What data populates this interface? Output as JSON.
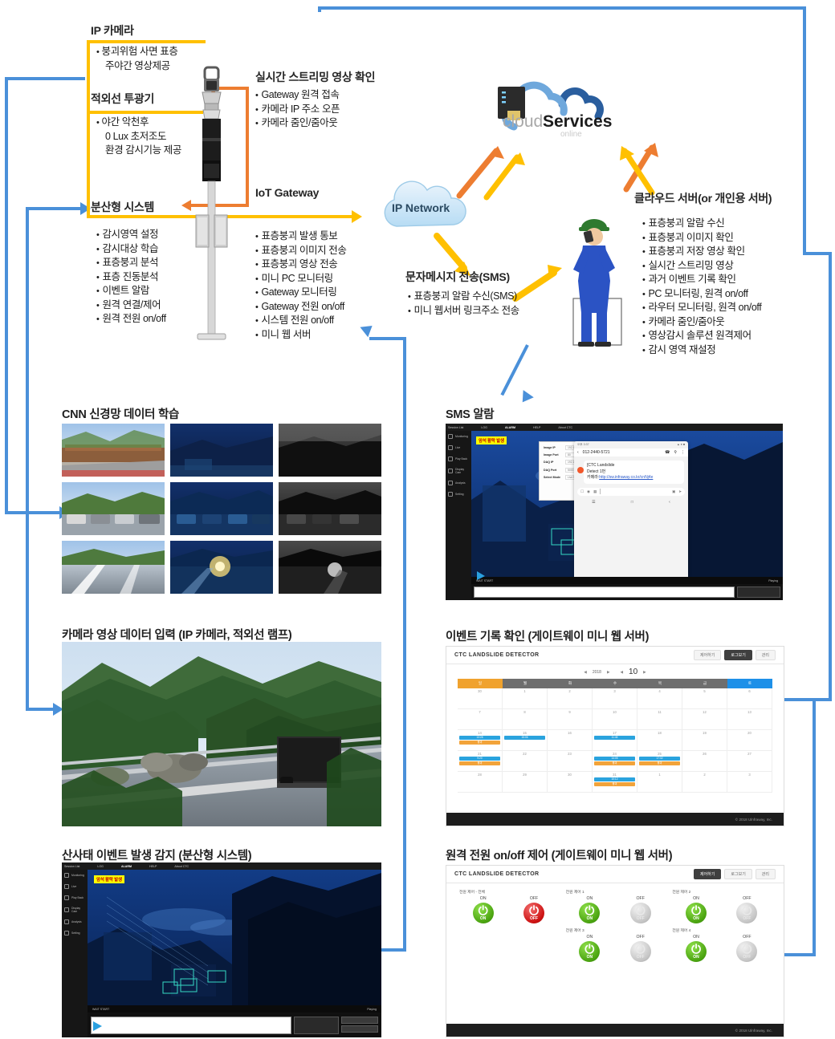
{
  "colors": {
    "blue_line": "#4a90d9",
    "yellow_line": "#FFC000",
    "orange_line": "#ED7D31",
    "accent_orange": "#F0A22E",
    "accent_blue": "#1E90E8",
    "green": "#4aa310",
    "red": "#cc1111"
  },
  "diagram": {
    "ip_camera": {
      "title": "IP 카메라",
      "items": [
        "붕괴위험 사면 표층",
        "주야간 영상제공"
      ]
    },
    "ir_projector": {
      "title": "적외선 투광기",
      "items": [
        "야간 악천후",
        "0 Lux 초저조도",
        "환경 감시기능 제공"
      ]
    },
    "streaming": {
      "title": "실시간 스트리밍 영상 확인",
      "items": [
        "Gateway 원격 접속",
        "카메라 IP 주소 오픈",
        "카메라 줌인/줌아웃"
      ]
    },
    "iot_gateway": {
      "title": "IoT Gateway"
    },
    "distributed_system": {
      "title": "분산형 시스템",
      "items": [
        "감시영역 설정",
        "감시대상 학습",
        "표층붕괴 분석",
        "표층 진동분석",
        "이벤트 알람",
        "원격 연결/제어",
        "원격 전원 on/off"
      ]
    },
    "gateway_functions": {
      "items": [
        "표층붕괴 발생 통보",
        "표층붕괴 이미지 전송",
        "표층붕괴 영상 전송",
        "미니 PC 모니터링",
        "Gateway 모니터링",
        "Gateway 전원 on/off",
        "시스템 전원 on/off",
        "미니 웹 서버"
      ]
    },
    "ip_network": {
      "label": "IP Network"
    },
    "cloud": {
      "label_light": "cloud",
      "label_bold": "Services",
      "sub": "online"
    },
    "sms_block": {
      "title": "문자메시지 전송(SMS)",
      "items": [
        "표층붕괴 알람 수신(SMS)",
        "미니 웹서버 링크주소 전송"
      ]
    },
    "cloud_server": {
      "title": "클라우드 서버(or 개인용 서버)",
      "items": [
        "표층붕괴 알람 수신",
        "표층붕괴 이미지 확인",
        "표층붕괴 저장 영상 확인",
        "실시간 스트리밍 영상",
        "과거 이벤트 기록 확인",
        "PC 모니터링, 원격 on/off",
        "라우터 모니터링, 원격 on/off",
        "카메라 줌인/줌아웃",
        "영상감시 솔루션 원격제어",
        "감시 영역 재설정"
      ]
    }
  },
  "sections": {
    "cnn": {
      "heading": "CNN 신경망 데이터 학습"
    },
    "camera_input": {
      "heading": "카메라 영상 데이터 입력 (IP 카메라, 적외선 램프)"
    },
    "landslide_detect": {
      "heading": "산사태 이벤트 발생 감지 (분산형 시스템)"
    },
    "sms_alarm": {
      "heading": "SMS 알람"
    },
    "event_log": {
      "heading": "이벤트 기록 확인 (게이트웨이 미니 웹 서버)"
    },
    "power_control": {
      "heading": "원격 전원 on/off 제어 (게이트웨이 미니 웹 서버)"
    }
  },
  "cctv_app": {
    "session_label": "Session List",
    "menu": [
      "LOG",
      "ALARM",
      "HELP",
      "About CTC"
    ],
    "sidebar": [
      "Monitoring",
      "Live",
      "Play Back",
      "Display Cam",
      "Analysis",
      "Setting"
    ],
    "alert_badge": "암석 활락 발생",
    "status_left": "WAIT START",
    "status_right": "Playing",
    "settings_dialog": {
      "rows": [
        {
          "label": "Image IP",
          "value": "192.168.0.12"
        },
        {
          "label": "Image Port",
          "value": "80"
        },
        {
          "label": "DAQ IP",
          "value": "192.168.0.13"
        },
        {
          "label": "DAQ Port",
          "value": "5000"
        },
        {
          "label": "Select Mode",
          "value": "Live Monitoring"
        }
      ]
    }
  },
  "phone_sms": {
    "status_time": "오후 3:37",
    "contact": "012-2440-5721",
    "message_lines": [
      "[CTC Landslide",
      "Detect    1번",
      "카메라:"
    ],
    "link": "http://sw.infraway.co.kr/cnNj4e"
  },
  "event_log_app": {
    "brand": "CTC LANDSLIDE DETECTOR",
    "buttons": [
      "제어하기",
      "로그보기",
      "관리"
    ],
    "year": "2018",
    "month": "10",
    "weekdays": [
      "일",
      "월",
      "화",
      "수",
      "목",
      "금",
      "토"
    ],
    "footer": "© 2018 Ulnfraway, Inc.",
    "weeks": [
      {
        "days": [
          "30",
          "1",
          "2",
          "3",
          "4",
          "5",
          "6"
        ],
        "events": []
      },
      {
        "days": [
          "7",
          "8",
          "9",
          "10",
          "11",
          "12",
          "13"
        ],
        "events": []
      },
      {
        "days": [
          "14",
          "15",
          "16",
          "17",
          "18",
          "19",
          "20"
        ],
        "events": [
          {
            "col": 0,
            "blue": "13:28",
            "orange": "붕괴"
          },
          {
            "col": 1,
            "blue": "15:06",
            "orange": ""
          },
          {
            "col": 3,
            "blue": "11:45",
            "orange": ""
          }
        ]
      },
      {
        "days": [
          "21",
          "22",
          "23",
          "24",
          "25",
          "26",
          "27"
        ],
        "events": [
          {
            "col": 0,
            "blue": "9:20",
            "orange": "붕괴"
          },
          {
            "col": 3,
            "blue": "14:05",
            "orange": "붕괴"
          },
          {
            "col": 4,
            "blue": "17:32",
            "orange": "붕괴"
          }
        ]
      },
      {
        "days": [
          "28",
          "29",
          "30",
          "31",
          "1",
          "2",
          "3"
        ],
        "events": [
          {
            "col": 3,
            "blue": "10:12",
            "orange": "붕괴"
          }
        ]
      }
    ]
  },
  "power_app": {
    "brand": "CTC LANDSLIDE DETECTOR",
    "buttons": [
      "제어하기",
      "로그보기",
      "관리"
    ],
    "groups": [
      {
        "label": "전원 제어 - 전체",
        "on_caption": "ON",
        "off_caption": "OFF",
        "on_state": "ON",
        "off_state": "OFF",
        "on_active": true,
        "off_active": true
      },
      {
        "label": "전원 제어 1",
        "on_caption": "ON",
        "off_caption": "OFF",
        "on_state": "ON",
        "off_state": "OFF",
        "on_active": true,
        "off_active": false
      },
      {
        "label": "전원 제어 2",
        "on_caption": "ON",
        "off_caption": "OFF",
        "on_state": "ON",
        "off_state": "OFF",
        "on_active": true,
        "off_active": false
      },
      {
        "label": "전원 제어 3",
        "on_caption": "ON",
        "off_caption": "OFF",
        "on_state": "ON",
        "off_state": "OFF",
        "on_active": true,
        "off_active": false
      },
      {
        "label": "전원 제어 4",
        "on_caption": "ON",
        "off_caption": "OFF",
        "on_state": "ON",
        "off_state": "OFF",
        "on_active": true,
        "off_active": false
      }
    ],
    "footer": "© 2018 Ulnfraway, Inc."
  }
}
